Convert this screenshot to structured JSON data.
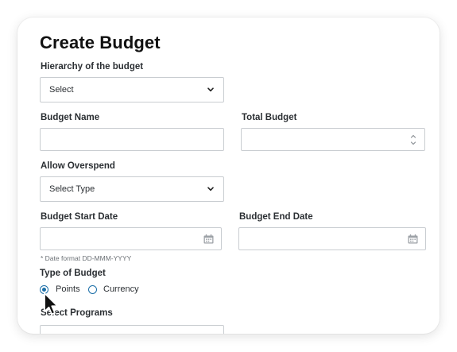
{
  "form": {
    "title": "Create Budget",
    "hierarchy": {
      "label": "Hierarchy of the budget",
      "value": "Select"
    },
    "budget_name": {
      "label": "Budget Name",
      "value": ""
    },
    "total_budget": {
      "label": "Total Budget",
      "value": ""
    },
    "allow_overspend": {
      "label": "Allow Overspend",
      "value": "Select Type"
    },
    "start_date": {
      "label": "Budget Start Date",
      "value": "",
      "hint": "* Date format DD-MMM-YYYY"
    },
    "end_date": {
      "label": "Budget End Date",
      "value": ""
    },
    "budget_type": {
      "label": "Type of Budget",
      "options": [
        {
          "label": "Points",
          "selected": true
        },
        {
          "label": "Currency",
          "selected": false
        }
      ]
    },
    "programs": {
      "label": "Select Programs"
    }
  },
  "colors": {
    "accent": "#1c6fa8",
    "border": "#c9cdd1",
    "text": "#2b2f33"
  },
  "icons": [
    "chevron-down-icon",
    "spinner-arrows-icon",
    "calendar-icon",
    "mouse-cursor-icon"
  ]
}
